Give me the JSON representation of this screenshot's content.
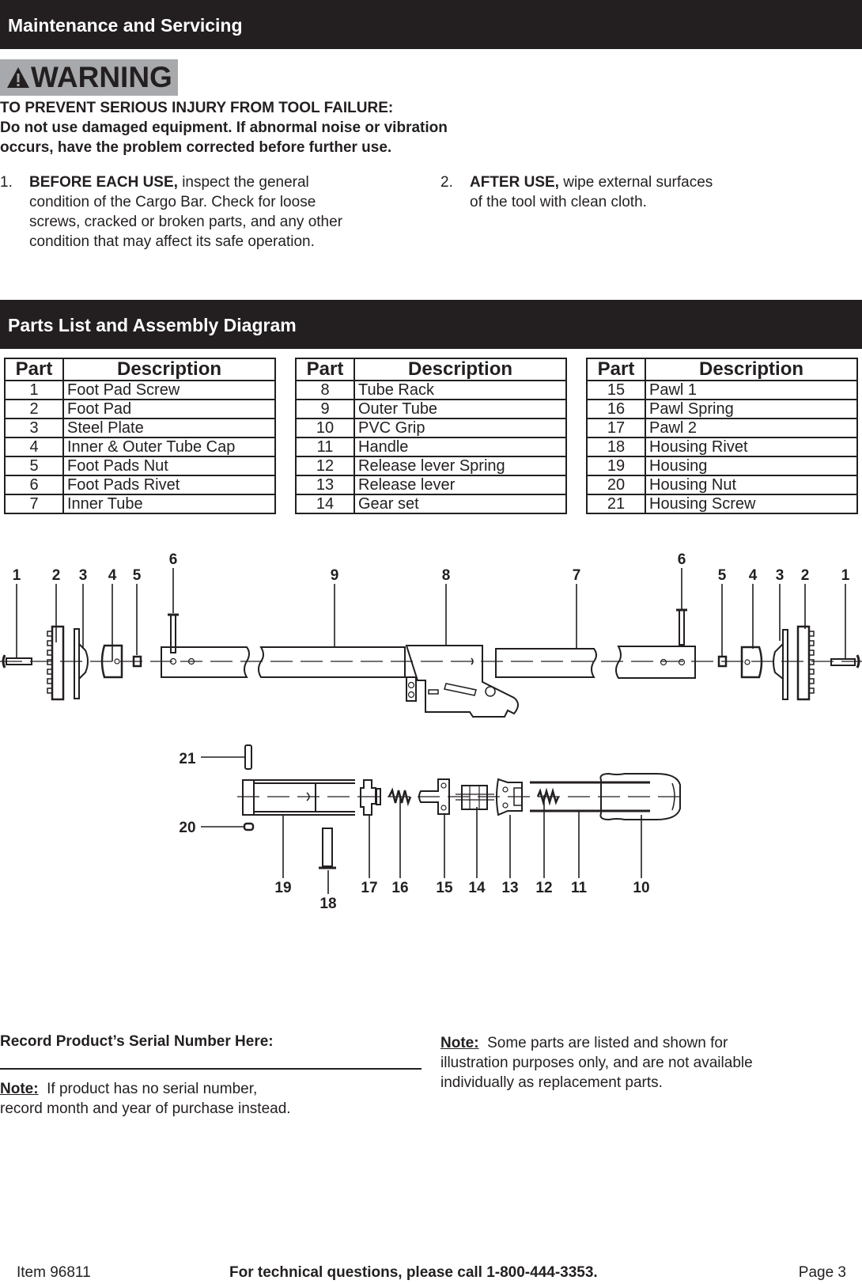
{
  "maintenance": {
    "title": "Maintenance and Servicing",
    "warning_label": "WARNING",
    "warning_heading": "TO PREVENT SERIOUS INJURY FROM TOOL FAILURE:",
    "warning_line1": "Do not use damaged equipment.  If abnormal noise or vibration",
    "warning_line2": "occurs, have the problem corrected before further use.",
    "items": [
      {
        "num": "1.",
        "bold": "BEFORE EACH USE,",
        "lines": [
          " inspect the general",
          "condition of the Cargo Bar.  Check for loose",
          "screws, cracked or broken parts, and any other",
          "condition that may affect its safe operation."
        ]
      },
      {
        "num": "2.",
        "bold": "AFTER USE,",
        "lines": [
          " wipe external surfaces",
          "of the tool with clean cloth."
        ]
      }
    ]
  },
  "parts": {
    "title": "Parts List and Assembly Diagram",
    "col_part": "Part",
    "col_desc": "Description",
    "tables": [
      [
        {
          "part": "1",
          "desc": "Foot Pad Screw"
        },
        {
          "part": "2",
          "desc": "Foot Pad"
        },
        {
          "part": "3",
          "desc": "Steel Plate"
        },
        {
          "part": "4",
          "desc": "Inner & Outer Tube Cap"
        },
        {
          "part": "5",
          "desc": "Foot Pads Nut"
        },
        {
          "part": "6",
          "desc": "Foot Pads Rivet"
        },
        {
          "part": "7",
          "desc": "Inner Tube"
        }
      ],
      [
        {
          "part": "8",
          "desc": "Tube Rack"
        },
        {
          "part": "9",
          "desc": "Outer Tube"
        },
        {
          "part": "10",
          "desc": "PVC Grip"
        },
        {
          "part": "11",
          "desc": "Handle"
        },
        {
          "part": "12",
          "desc": "Release lever Spring"
        },
        {
          "part": "13",
          "desc": "Release lever"
        },
        {
          "part": "14",
          "desc": "Gear set"
        }
      ],
      [
        {
          "part": "15",
          "desc": "Pawl 1"
        },
        {
          "part": "16",
          "desc": "Pawl Spring"
        },
        {
          "part": "17",
          "desc": "Pawl 2"
        },
        {
          "part": "18",
          "desc": "Housing Rivet"
        },
        {
          "part": "19",
          "desc": "Housing"
        },
        {
          "part": "20",
          "desc": "Housing Nut"
        },
        {
          "part": "21",
          "desc": "Housing Screw"
        }
      ]
    ]
  },
  "diagram": {
    "callouts_top": [
      "1",
      "2",
      "3",
      "4",
      "5",
      "6",
      "9",
      "8",
      "7",
      "6",
      "5",
      "4",
      "3",
      "2",
      "1"
    ],
    "callouts_bottom": [
      "21",
      "20",
      "19",
      "18",
      "17",
      "16",
      "15",
      "14",
      "13",
      "12",
      "11",
      "10"
    ]
  },
  "serial": {
    "label": "Record Product’s Serial Number Here:",
    "note_label": "Note:",
    "note_line1": "  If product has no serial number,",
    "note_line2": "record month and year of purchase instead."
  },
  "note_right": {
    "label": "Note:",
    "line1": "  Some parts are listed and shown for",
    "line2": "illustration purposes only, and are not available",
    "line3": "individually as replacement parts."
  },
  "footer": {
    "item": "Item 96811",
    "contact": "For technical questions, please call 1-800-444-3353.",
    "page": "Page 3"
  }
}
